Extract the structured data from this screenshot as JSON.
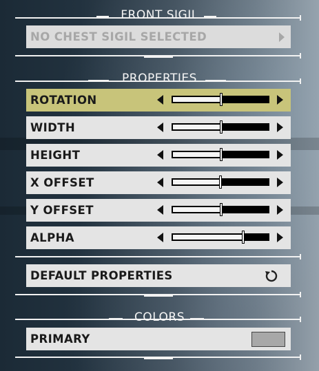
{
  "front_sigil": {
    "title": "FRONT SIGIL",
    "selector_label": "NO CHEST SIGIL SELECTED"
  },
  "properties": {
    "title": "PROPERTIES",
    "sliders": [
      {
        "label": "ROTATION",
        "value": 0.5,
        "selected": true
      },
      {
        "label": "WIDTH",
        "value": 0.5,
        "selected": false
      },
      {
        "label": "HEIGHT",
        "value": 0.5,
        "selected": false
      },
      {
        "label": "X OFFSET",
        "value": 0.49,
        "selected": false
      },
      {
        "label": "Y OFFSET",
        "value": 0.5,
        "selected": false
      },
      {
        "label": "ALPHA",
        "value": 0.73,
        "selected": false
      }
    ],
    "default_button_label": "DEFAULT PROPERTIES"
  },
  "colors": {
    "title": "COLORS",
    "primary_label": "PRIMARY",
    "primary_color": "#a8a8a8"
  },
  "theme": {
    "selected_row": "#c8c47a",
    "row": "#e4e4e4",
    "disabled_text": "#a7a7a7"
  }
}
